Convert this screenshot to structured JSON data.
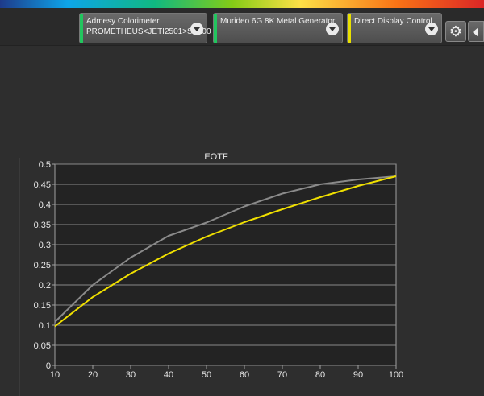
{
  "devices": [
    {
      "line1": "Admesy Colorimeter",
      "line2": "PROMETHEUS<JETI2501>ST100",
      "status_color": "#22c55e"
    },
    {
      "line1": "Murideo 6G 8K Metal Generator",
      "line2": "",
      "status_color": "#22c55e"
    },
    {
      "line1": "Direct Display Control",
      "line2": "",
      "status_color": "#e8e000"
    }
  ],
  "chart_data": {
    "type": "line",
    "title": "EOTF",
    "xlabel": "",
    "ylabel": "",
    "xlim": [
      10,
      100
    ],
    "ylim": [
      0,
      0.5
    ],
    "xticks": [
      "10",
      "20",
      "30",
      "40",
      "50",
      "60",
      "70",
      "80",
      "90",
      "100"
    ],
    "yticks": [
      "0",
      "0.05",
      "0.1",
      "0.15",
      "0.2",
      "0.25",
      "0.3",
      "0.35",
      "0.4",
      "0.45",
      "0.5"
    ],
    "grid": true,
    "series": [
      {
        "color": "#8a8a8a",
        "x": [
          10,
          20,
          30,
          40,
          50,
          60,
          70,
          80,
          90,
          100
        ],
        "y": [
          0.108,
          0.2,
          0.268,
          0.322,
          0.355,
          0.395,
          0.427,
          0.45,
          0.462,
          0.47
        ]
      },
      {
        "color": "#f0e000",
        "x": [
          10,
          20,
          30,
          40,
          50,
          60,
          70,
          80,
          90,
          100
        ],
        "y": [
          0.097,
          0.17,
          0.228,
          0.278,
          0.32,
          0.356,
          0.388,
          0.418,
          0.446,
          0.47
        ]
      }
    ]
  }
}
